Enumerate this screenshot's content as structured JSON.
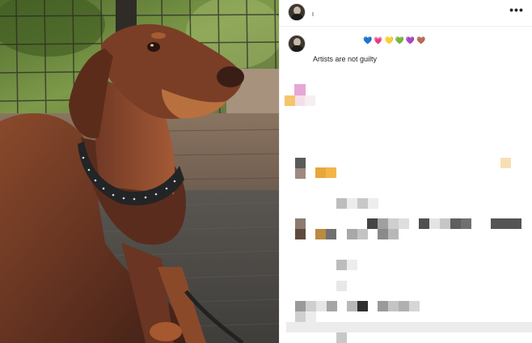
{
  "header": {
    "more_label": "•••"
  },
  "caption": {
    "emojis": [
      "💙",
      "💗",
      "💛",
      "💚",
      "💜",
      "🤎"
    ],
    "text": "Artists are not guilty"
  },
  "photo": {
    "subject": "doberman-dog"
  },
  "colors": {
    "pixel_mosaic": [
      "#e8a6d8",
      "#f5c56b",
      "#f3dfe9",
      "#5a5a5a",
      "#9e8a80",
      "#e7a73a",
      "#f7dfb4",
      "#bdbdbd",
      "#c8c8c8",
      "#707070",
      "#8c7b6e",
      "#5f4a3f",
      "#444444",
      "#a0a0a0",
      "#cfcfcf",
      "#dedede"
    ]
  }
}
